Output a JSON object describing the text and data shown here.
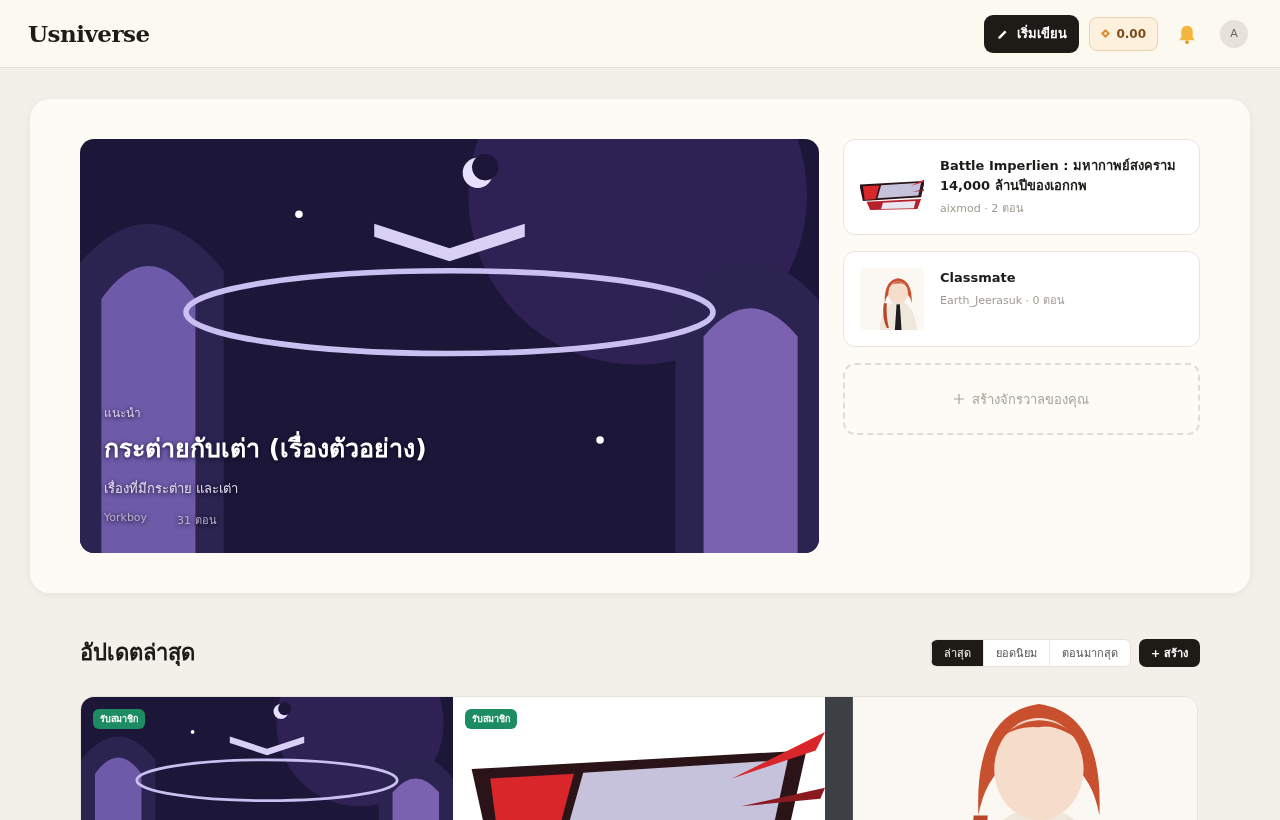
{
  "header": {
    "logo": "Usniverse",
    "write_button": "เริ่มเขียน",
    "coins": "0.00",
    "avatar": "A"
  },
  "featured": {
    "label": "แนะนำ",
    "title": "กระต่ายกับเต่า (เรื่องตัวอย่าง)",
    "description": "เรื่องที่มีกระต่าย และเต่า",
    "author": "Yorkboy",
    "episodes": "31 ตอน",
    "image": {
      "kind": "picture"
    }
  },
  "side_stories": [
    {
      "title": "Battle Imperlien : มหากาพย์สงคราม 14,000 ล้านปีของเอกกพ",
      "meta": "aixmod · 2 ตอน",
      "thumb": {
        "kind": "picture"
      }
    },
    {
      "title": "Classmate",
      "meta": "Earth_Jeerasuk · 0 ตอน",
      "thumb": {
        "kind": "picture"
      }
    }
  ],
  "create_universe": "สร้างจักรวาลของคุณ",
  "latest": {
    "heading": "อัปเดตล่าสุด",
    "sort_tabs": [
      {
        "label": "ล่าสุด",
        "selected": true
      },
      {
        "label": "ยอดนิยม",
        "selected": false
      },
      {
        "label": "ตอนมากสุด",
        "selected": false
      }
    ],
    "create_button": "+ สร้าง",
    "cards": [
      {
        "badge": "รับสมาชิก",
        "kind": "picture"
      },
      {
        "badge": "รับสมาชิก",
        "kind": "picture"
      },
      {
        "kind": "picture"
      }
    ]
  }
}
